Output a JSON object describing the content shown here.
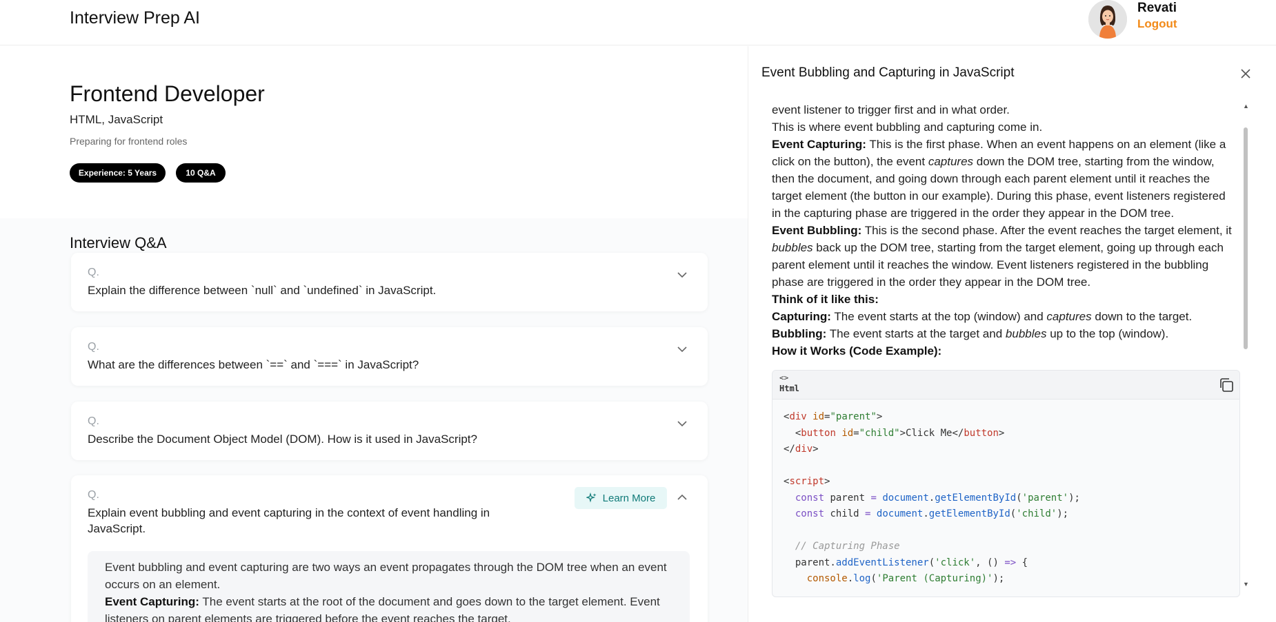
{
  "header": {
    "app_title": "Interview Prep AI",
    "user_name": "Revati",
    "logout_label": "Logout"
  },
  "role": {
    "title": "Frontend Developer",
    "topics": "HTML, JavaScript",
    "description": "Preparing for frontend roles",
    "experience_badge": "Experience: 5 Years",
    "qa_count_badge": "10 Q&A"
  },
  "qa_section": {
    "heading": "Interview Q&A",
    "questions": [
      {
        "prefix": "Q.",
        "text": "Explain the difference between `null` and `undefined` in JavaScript."
      },
      {
        "prefix": "Q.",
        "text": "What are the differences between `==` and `===` in JavaScript?"
      },
      {
        "prefix": "Q.",
        "text": "Describe the Document Object Model (DOM). How is it used in JavaScript?"
      },
      {
        "prefix": "Q.",
        "text": "Explain event bubbling and event capturing in the context of event handling in JavaScript."
      }
    ],
    "learn_more_label": "Learn More",
    "open_answer": {
      "intro": "Event bubbling and event capturing are two ways an event propagates through the DOM tree when an event occurs on an element.",
      "capturing_label": "Event Capturing:",
      "capturing_text": "The event starts at the root of the document and goes down to the target element. Event listeners on parent elements are triggered before the event reaches the target."
    }
  },
  "panel": {
    "title": "Event Bubbling and Capturing in JavaScript",
    "line1": "event listener to trigger first and in what order.",
    "line2": "This is where event bubbling and capturing come in.",
    "capturing_label": "Event Capturing:",
    "capturing_a": "This is the first phase. When an event happens on an element (like a",
    "capturing_b1": "click on the button), the event",
    "capturing_b_em": "captures",
    "capturing_b2": "down the DOM tree, starting from the window,",
    "capturing_c": "then the document, and going down through each parent element until it reaches the",
    "capturing_d": "target element (the button in our example). During this phase, event listeners registered",
    "capturing_e": "in the capturing phase are triggered in the order they appear in the DOM tree.",
    "bubbling_label": "Event Bubbling:",
    "bubbling_a": "This is the second phase. After the event reaches the target element, it",
    "bubbling_b_em": "bubbles",
    "bubbling_b": "back up the DOM tree, starting from the target element, going up through each",
    "bubbling_c": "parent element until it reaches the window. Event listeners registered in the bubbling",
    "bubbling_d": "phase are triggered in the order they appear in the DOM tree.",
    "think_label": "Think of it like this:",
    "cap_label": "Capturing:",
    "cap_text1": "The event starts at the top (window) and",
    "cap_em": "captures",
    "cap_text2": "down to the target.",
    "bub_label": "Bubbling:",
    "bub_text1": "The event starts at the target and",
    "bub_em": "bubbles",
    "bub_text2": "up to the top (window).",
    "how_label": "How it Works (Code Example):",
    "code": {
      "icon": "<>",
      "language": "Html"
    }
  }
}
